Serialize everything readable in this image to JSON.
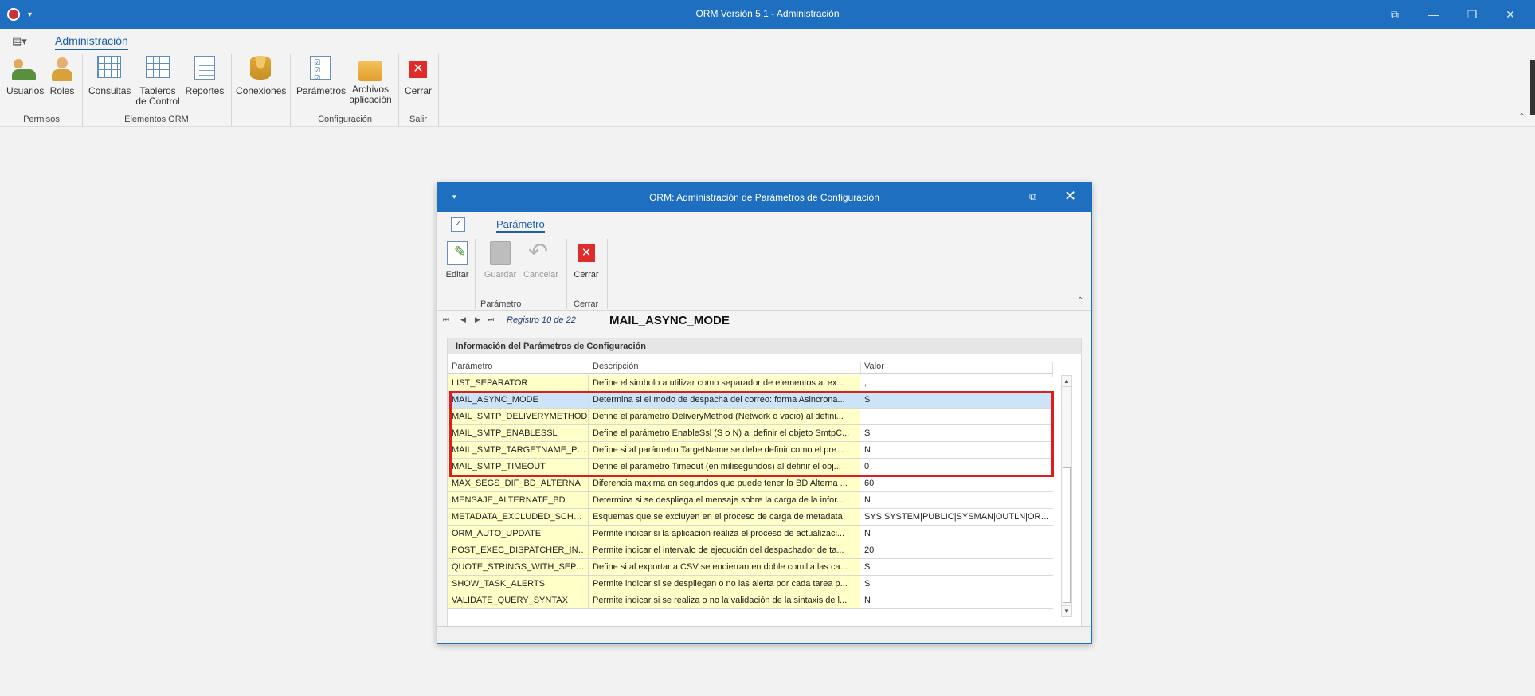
{
  "window": {
    "title": "ORM Versión 5.1 - Administración",
    "quick_access_arrow": "▾",
    "controls": [
      "⧉",
      "—",
      "❐",
      "✕"
    ]
  },
  "ribbon": {
    "menu_icon": "▤▾",
    "tab": "Administración",
    "buttons": {
      "usuarios": "Usuarios",
      "roles": "Roles",
      "consultas": "Consultas",
      "tableros_l1": "Tableros",
      "tableros_l2": "de Control",
      "reportes": "Reportes",
      "conexiones": "Conexiones",
      "parametros": "Parámetros",
      "archivos_l1": "Archivos",
      "archivos_l2": "aplicación",
      "cerrar": "Cerrar"
    },
    "groups": {
      "permisos": "Permisos",
      "elementos": "Elementos ORM",
      "configuracion": "Configuración",
      "salir": "Salir"
    },
    "collapse_icon": "⌃"
  },
  "dialog": {
    "title": "ORM: Administración de Parámetros de Configuración",
    "arrow": "▾",
    "restore_icon": "⧉",
    "close_icon": "✕",
    "tab": "Parámetro",
    "buttons": {
      "editar": "Editar",
      "guardar": "Guardar",
      "cancelar": "Cancelar",
      "cerrar": "Cerrar"
    },
    "groups": {
      "parametro": "Parámetro",
      "cerrar": "Cerrar"
    },
    "collapse_icon": "⌃",
    "nav": {
      "first": "⏮",
      "prev": "◀",
      "next": "▶",
      "last": "⏭",
      "record": "Registro 10 de 22"
    },
    "heading": "MAIL_ASYNC_MODE",
    "group_title": "Información del Parámetros de Configuración",
    "columns": [
      "Parámetro",
      "Descripción",
      "Valor"
    ],
    "rows": [
      {
        "p": "LIST_SEPARATOR",
        "d": "Define el simbolo a utilizar como separador de elementos al ex...",
        "v": ","
      },
      {
        "p": "MAIL_ASYNC_MODE",
        "d": "Determina si el modo de despacha del correo: forma Asincrona...",
        "v": "S"
      },
      {
        "p": "MAIL_SMTP_DELIVERYMETHOD",
        "d": "Define el parámetro DeliveryMethod (Network o vacio) al defini...",
        "v": ""
      },
      {
        "p": "MAIL_SMTP_ENABLESSL",
        "d": "Define el parámetro EnableSsl (S o N) al definir el objeto SmtpC...",
        "v": "S"
      },
      {
        "p": "MAIL_SMTP_TARGETNAME_PRE...",
        "d": "Define si al parámetro TargetName se debe definir como el pre...",
        "v": "N"
      },
      {
        "p": "MAIL_SMTP_TIMEOUT",
        "d": "Define el parámetro Timeout (en milisegundos) al definir el obj...",
        "v": "0"
      },
      {
        "p": "MAX_SEGS_DIF_BD_ALTERNA",
        "d": "Diferencia maxima en segundos que puede tener la BD Alterna ...",
        "v": "60"
      },
      {
        "p": "MENSAJE_ALTERNATE_BD",
        "d": "Determina si se despliega el mensaje sobre la carga de la infor...",
        "v": "N"
      },
      {
        "p": "METADATA_EXCLUDED_SCHEM...",
        "d": "Esquemas que se excluyen en el proceso de carga de metadata",
        "v": "SYS|SYSTEM|PUBLIC|SYSMAN|OUTLN|ORACL..."
      },
      {
        "p": "ORM_AUTO_UPDATE",
        "d": "Permite indicar si la aplicación realiza el proceso de actualizaci...",
        "v": "N"
      },
      {
        "p": "POST_EXEC_DISPATCHER_INTE...",
        "d": "Permite indicar el intervalo de ejecución del despachador de ta...",
        "v": "20"
      },
      {
        "p": "QUOTE_STRINGS_WITH_SEPAR...",
        "d": "Define si al exportar a CSV se encierran en doble comilla las ca...",
        "v": "S"
      },
      {
        "p": "SHOW_TASK_ALERTS",
        "d": "Permite indicar si se despliegan o no las alerta por cada tarea p...",
        "v": "S"
      },
      {
        "p": "VALIDATE_QUERY_SYNTAX",
        "d": "Permite indicar si se realiza o no la validación de la sintaxis de l...",
        "v": "N"
      }
    ],
    "scroll": {
      "up": "▲",
      "down": "▼"
    }
  },
  "colors": {
    "titlebar": "#1e6fbf",
    "row_param": "#ffffc8",
    "selected_row": "#cde3f7",
    "highlight_border": "#e21b1b",
    "close_red": "#e02b2b"
  }
}
